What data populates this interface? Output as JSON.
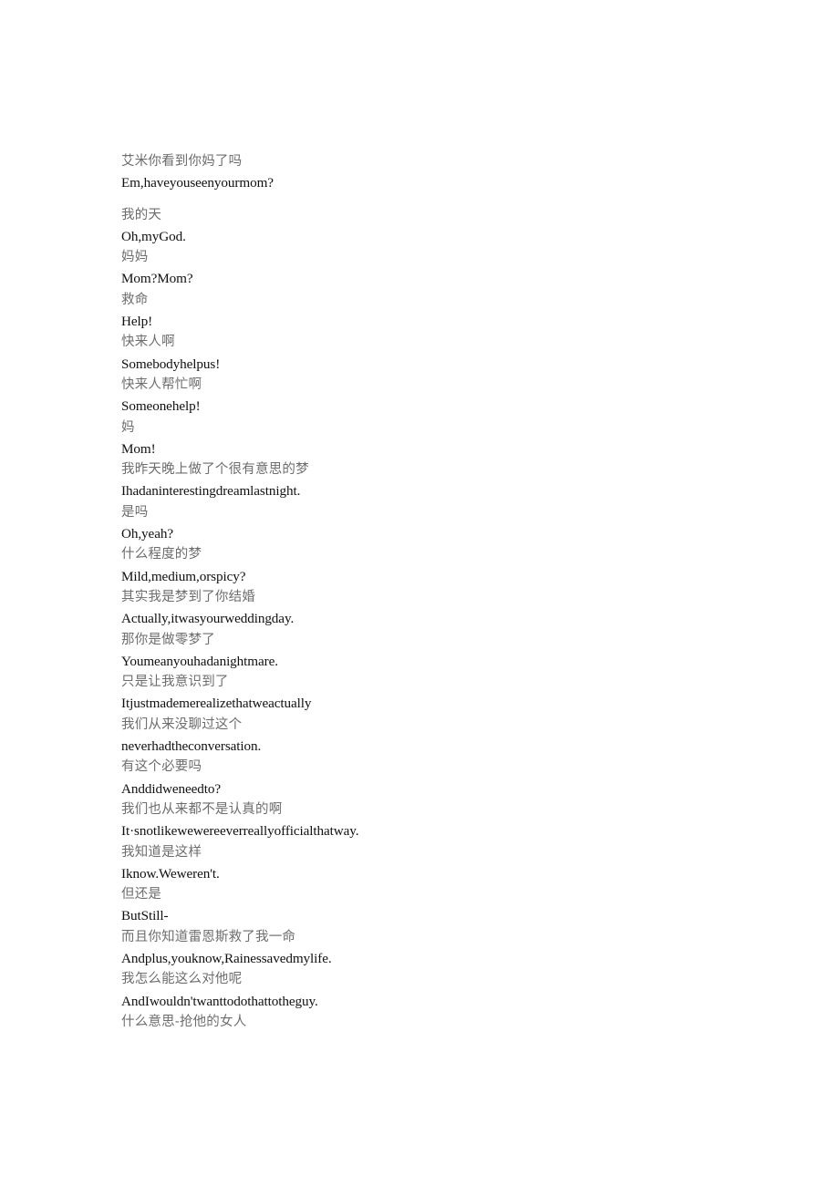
{
  "document": {
    "page_background": "#ffffff",
    "zh_text_color": "#6d6d6d",
    "en_text_color": "#101010",
    "paragraphs": [
      {
        "id": "p1",
        "lines": [
          {
            "lang": "zh",
            "text": "艾米你看到你妈了吗"
          },
          {
            "lang": "en",
            "text": "Em,haveyouseenyourmom?"
          }
        ]
      },
      {
        "id": "p2",
        "spaced": true,
        "lines": [
          {
            "lang": "zh",
            "text": "我的天"
          },
          {
            "lang": "en",
            "text": "Oh,myGod."
          },
          {
            "lang": "zh",
            "text": "妈妈"
          },
          {
            "lang": "en",
            "text": "Mom?Mom?"
          },
          {
            "lang": "zh",
            "text": "救命"
          },
          {
            "lang": "en",
            "text": "Help!"
          },
          {
            "lang": "zh",
            "text": "快来人啊"
          },
          {
            "lang": "en",
            "text": "Somebodyhelpus!"
          },
          {
            "lang": "zh",
            "text": "快来人帮忙啊"
          },
          {
            "lang": "en",
            "text": "Someonehelp!"
          },
          {
            "lang": "zh",
            "text": "妈"
          },
          {
            "lang": "en",
            "text": "Mom!"
          },
          {
            "lang": "zh",
            "text": "我昨天晚上做了个很有意思的梦"
          },
          {
            "lang": "en",
            "text": "Ihadaninterestingdreamlastnight."
          },
          {
            "lang": "zh",
            "text": "是吗"
          },
          {
            "lang": "en",
            "text": "Oh,yeah?"
          },
          {
            "lang": "zh",
            "text": "什么程度的梦"
          },
          {
            "lang": "en",
            "text": "Mild,medium,orspicy?"
          },
          {
            "lang": "zh",
            "text": "其实我是梦到了你结婚"
          },
          {
            "lang": "en",
            "text": "Actually,itwasyourweddingday."
          },
          {
            "lang": "zh",
            "text": "那你是做零梦了"
          },
          {
            "lang": "en",
            "text": "Youmeanyouhadanightmare."
          },
          {
            "lang": "zh",
            "text": "只是让我意识到了"
          },
          {
            "lang": "en",
            "text": "Itjustmademerealizethatweactually"
          },
          {
            "lang": "zh",
            "text": "我们从来没聊过这个"
          },
          {
            "lang": "en",
            "text": "neverhadtheconversation."
          },
          {
            "lang": "zh",
            "text": "有这个必要吗"
          },
          {
            "lang": "en",
            "text": "Anddidweneedto?"
          },
          {
            "lang": "zh",
            "text": "我们也从来都不是认真的啊"
          },
          {
            "lang": "en",
            "text": "It·snotlikewewereeverreallyofficialthatway."
          },
          {
            "lang": "zh",
            "text": "我知道是这样"
          },
          {
            "lang": "en",
            "text": "Iknow.Weweren't."
          },
          {
            "lang": "zh",
            "text": "但还是"
          },
          {
            "lang": "en",
            "text": "ButStill-"
          },
          {
            "lang": "zh",
            "text": "而且你知道雷恩斯救了我一命"
          },
          {
            "lang": "en",
            "text": "Andplus,youknow,Rainessavedmylife."
          },
          {
            "lang": "zh",
            "text": "我怎么能这么对他呢"
          },
          {
            "lang": "en",
            "text": "AndIwouldn'twanttodothattotheguy."
          },
          {
            "lang": "zh",
            "text": "什么意思-抢他的女人"
          }
        ]
      }
    ]
  }
}
